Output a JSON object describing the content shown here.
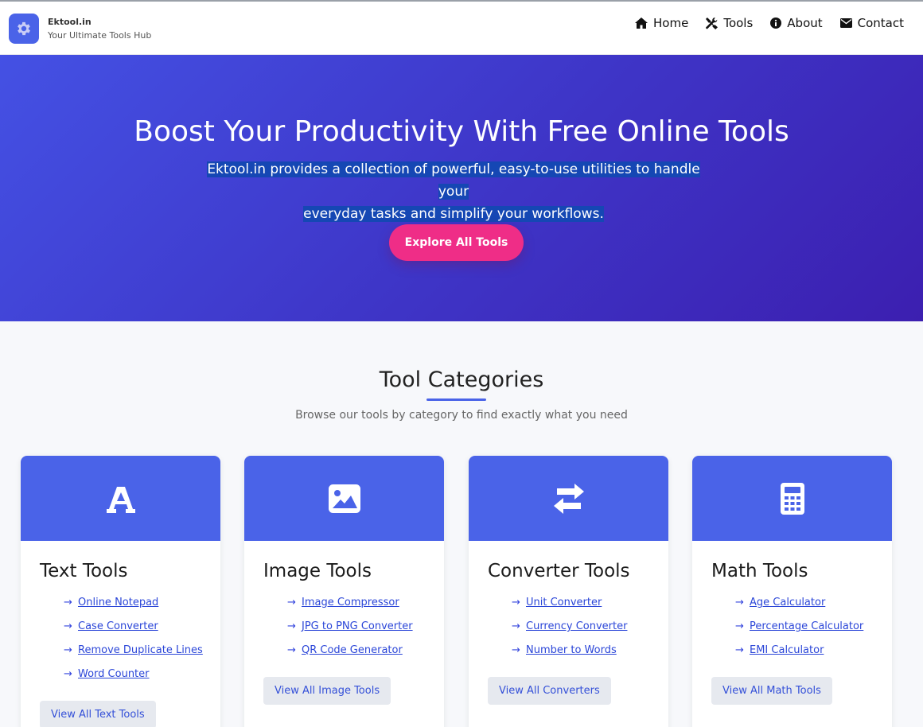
{
  "header": {
    "brand_name": "Ektool.in",
    "brand_tagline": "Your Ultimate Tools Hub",
    "nav": [
      {
        "label": "Home",
        "icon": "home-icon"
      },
      {
        "label": "Tools",
        "icon": "tools-icon"
      },
      {
        "label": "About",
        "icon": "info-icon"
      },
      {
        "label": "Contact",
        "icon": "envelope-icon"
      }
    ]
  },
  "hero": {
    "title": "Boost Your Productivity With Free Online Tools",
    "subtitle_line1": "Ektool.in provides a collection of powerful, easy-to-use utilities to handle your",
    "subtitle_line2": "everyday tasks and simplify your workflows.",
    "cta": "Explore All Tools"
  },
  "categories": {
    "title": "Tool Categories",
    "subtitle": "Browse our tools by category to find exactly what you need",
    "cards": [
      {
        "title": "Text Tools",
        "icon": "font-a-icon",
        "links": [
          "Online Notepad",
          "Case Converter",
          "Remove Duplicate Lines",
          "Word Counter"
        ],
        "button": "View All Text Tools"
      },
      {
        "title": "Image Tools",
        "icon": "image-icon",
        "links": [
          "Image Compressor",
          "JPG to PNG Converter",
          "QR Code Generator"
        ],
        "button": "View All Image Tools"
      },
      {
        "title": "Converter Tools",
        "icon": "exchange-arrows-icon",
        "links": [
          "Unit Converter",
          "Currency Converter",
          "Number to Words"
        ],
        "button": "View All Converters"
      },
      {
        "title": "Math Tools",
        "icon": "calculator-icon",
        "links": [
          "Age Calculator",
          "Percentage Calculator",
          "EMI Calculator"
        ],
        "button": "View All Math Tools"
      }
    ]
  },
  "colors": {
    "accent": "#4a63e8",
    "cta": "#ef2d87",
    "hero_start": "#4451e4",
    "hero_end": "#3c1fb0"
  }
}
